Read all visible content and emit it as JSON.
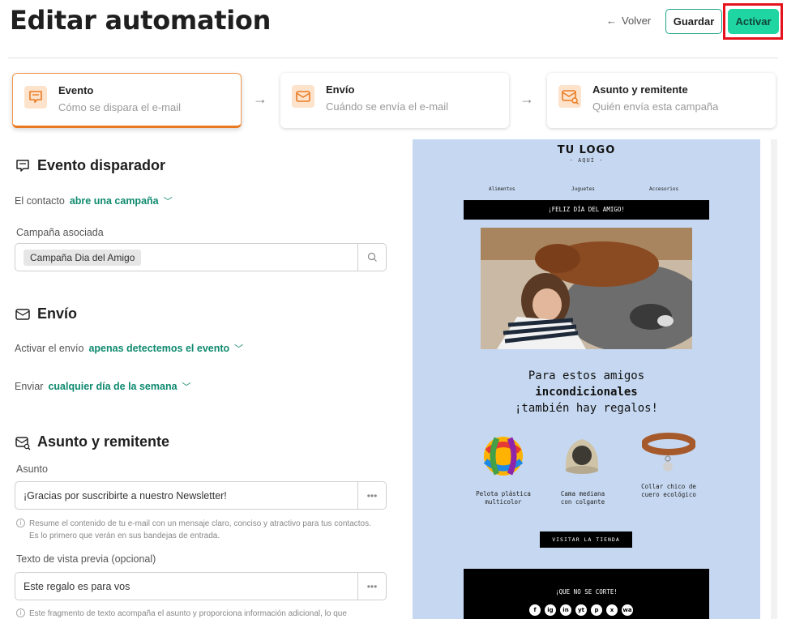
{
  "header": {
    "title": "Editar automation",
    "back_label": "Volver",
    "save_label": "Guardar",
    "activate_label": "Activar"
  },
  "steps": [
    {
      "title": "Evento",
      "subtitle": "Cómo se dispara el e-mail",
      "icon": "chat-bubble-icon"
    },
    {
      "title": "Envío",
      "subtitle": "Cuándo se envía el e-mail",
      "icon": "envelope-send-icon"
    },
    {
      "title": "Asunto y remitente",
      "subtitle": "Quién envía esta campaña",
      "icon": "envelope-search-icon"
    }
  ],
  "event": {
    "title": "Evento disparador",
    "contact_prefix": "El contacto",
    "contact_action": "abre una campaña",
    "campaign_label": "Campaña asociada",
    "campaign_value": "Campaña Dia del Amigo"
  },
  "send": {
    "title": "Envío",
    "activate_prefix": "Activar el envío",
    "activate_value": "apenas detectemos el evento",
    "send_prefix": "Enviar",
    "send_value": "cualquier día de la semana"
  },
  "subject": {
    "title": "Asunto y remitente",
    "subject_label": "Asunto",
    "subject_value": "¡Gracias por suscribirte a nuestro Newsletter!",
    "subject_hint": "Resume el contenido de tu e-mail con un mensaje claro, conciso y atractivo para tus contactos. Es lo primero que verán en sus bandejas de entrada.",
    "preview_label": "Texto de vista previa (opcional)",
    "preview_value": "Este regalo es para vos",
    "preview_hint": "Este fragmento de texto acompaña el asunto y proporciona información adicional, lo que"
  },
  "email_preview": {
    "logo": "TU LOGO",
    "logo_sub": "- AQUÍ -",
    "nav": [
      "Alimentos",
      "Juguetes",
      "Accesorios"
    ],
    "banner": "¡FELIZ DÍA DEL AMIGO!",
    "headline_1": "Para estos amigos",
    "headline_2": "incondicionales",
    "headline_3": "¡también hay regalos!",
    "products": [
      {
        "name_1": "Pelota plástica",
        "name_2": "multicolor"
      },
      {
        "name_1": "Cama mediana",
        "name_2": "con colgante"
      },
      {
        "name_1": "Collar chico de",
        "name_2": "cuero ecológico"
      }
    ],
    "cta": "VISITAR LA TIENDA",
    "footer_title": "¡QUE NO SE CORTE!",
    "social": [
      "f",
      "ig",
      "in",
      "yt",
      "p",
      "x",
      "wa"
    ]
  },
  "colors": {
    "accent": "#1fd6a3",
    "link": "#0f8a6f",
    "active_step": "#e97a22",
    "highlight": "#e5121d",
    "preview_bg": "#c6d8f1"
  }
}
